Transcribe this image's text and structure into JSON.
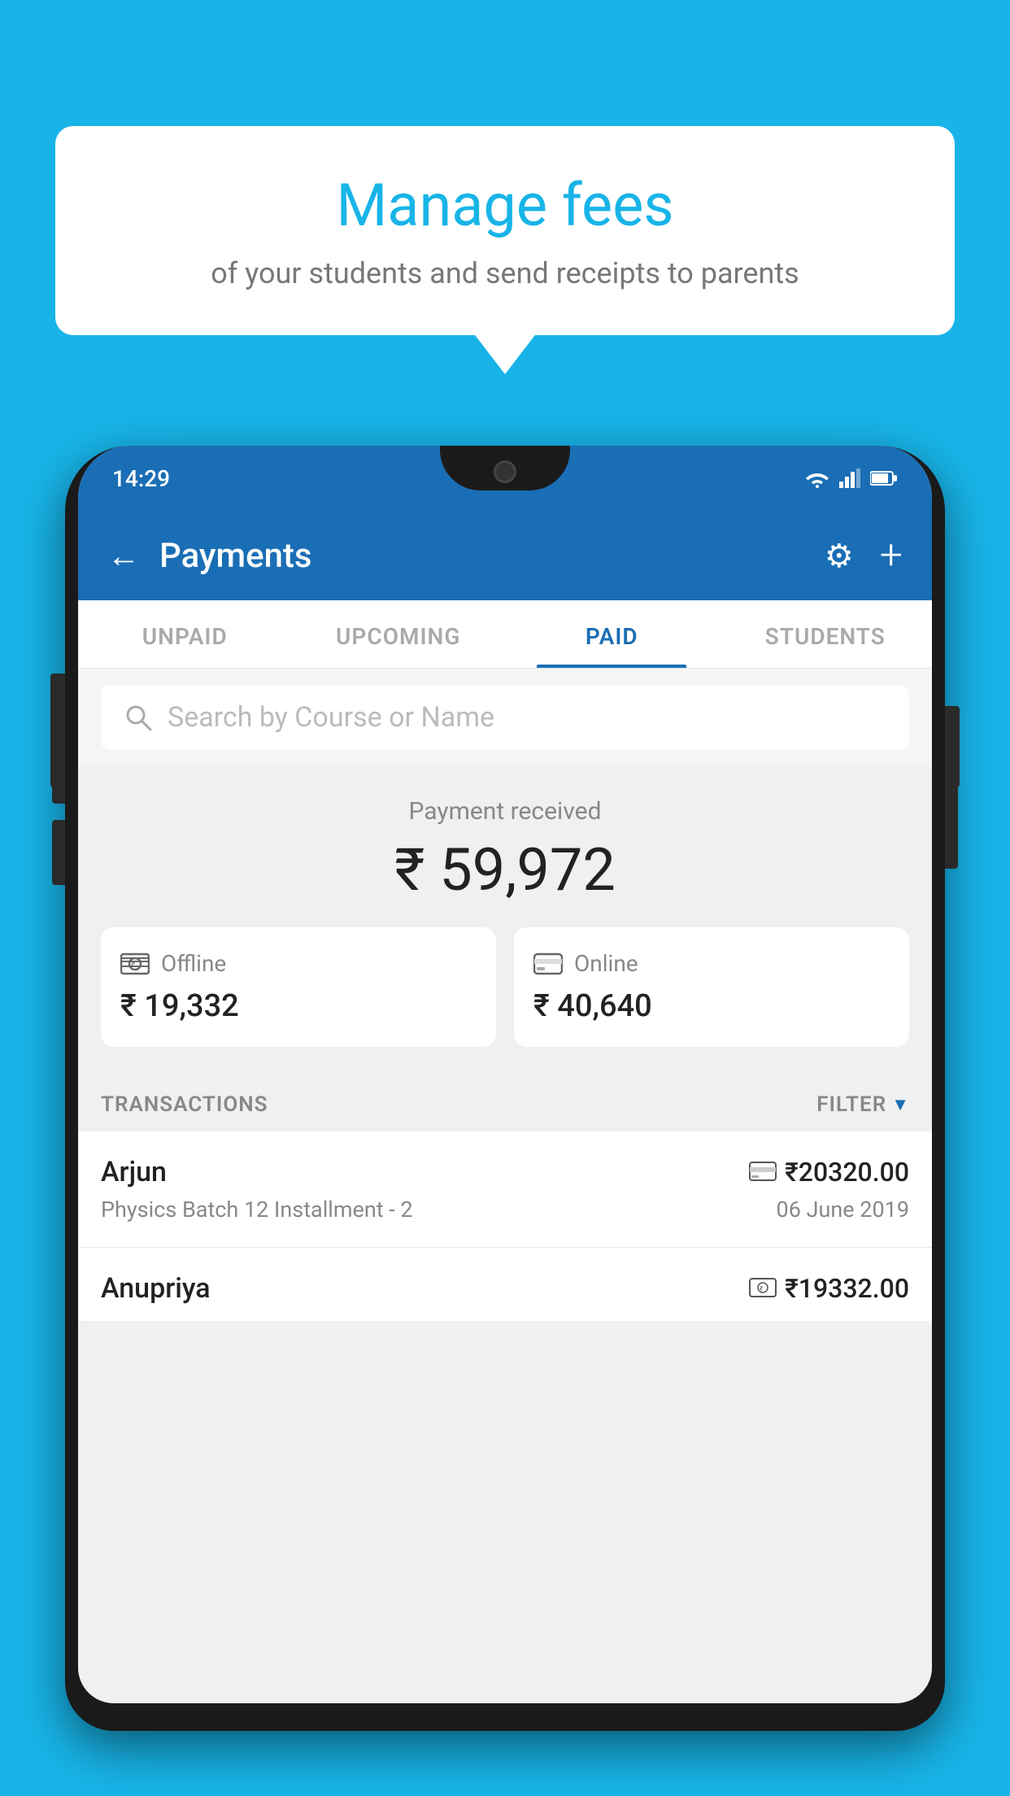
{
  "background_color": "#18b4e8",
  "speech_bubble": {
    "title": "Manage fees",
    "subtitle": "of your students and send receipts to parents"
  },
  "phone": {
    "status_bar": {
      "time": "14:29",
      "icons": [
        "wifi",
        "signal",
        "battery"
      ]
    },
    "toolbar": {
      "back_icon": "←",
      "title": "Payments",
      "settings_icon": "⚙",
      "add_icon": "+"
    },
    "tabs": [
      {
        "label": "UNPAID",
        "active": false
      },
      {
        "label": "UPCOMING",
        "active": false
      },
      {
        "label": "PAID",
        "active": true
      },
      {
        "label": "STUDENTS",
        "active": false
      }
    ],
    "search": {
      "placeholder": "Search by Course or Name",
      "icon": "search"
    },
    "payment_summary": {
      "received_label": "Payment received",
      "total_amount": "₹ 59,972",
      "offline": {
        "label": "Offline",
        "amount": "₹ 19,332"
      },
      "online": {
        "label": "Online",
        "amount": "₹ 40,640"
      }
    },
    "transactions_section": {
      "label": "TRANSACTIONS",
      "filter_label": "FILTER"
    },
    "transactions": [
      {
        "name": "Arjun",
        "amount": "₹20320.00",
        "payment_type": "card",
        "course": "Physics Batch 12 Installment - 2",
        "date": "06 June 2019"
      },
      {
        "name": "Anupriya",
        "amount": "₹19332.00",
        "payment_type": "cash",
        "course": "",
        "date": ""
      }
    ]
  }
}
